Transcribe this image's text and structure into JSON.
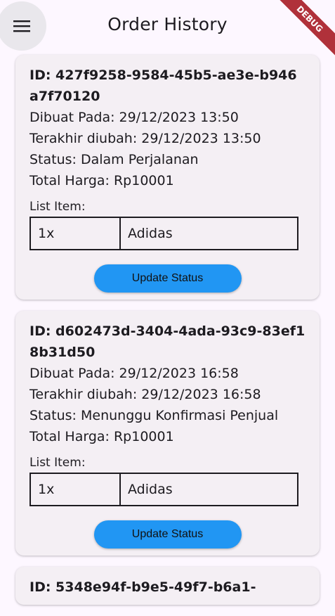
{
  "appbar": {
    "title": "Order History",
    "debug_banner": "DEBUG"
  },
  "labels": {
    "created": "Dibuat Pada: ",
    "updated": "Terakhir diubah: ",
    "status": "Status: ",
    "total": "Total Harga: ",
    "items": "List Item:",
    "update_button": "Update Status"
  },
  "orders": [
    {
      "id": "ID: 427f9258-9584-45b5-ae3e-b946a7f70120",
      "created": "Dibuat Pada: 29/12/2023 13:50",
      "updated": "Terakhir diubah: 29/12/2023 13:50",
      "status": "Status: Dalam Perjalanan",
      "total": "Total Harga: Rp10001",
      "items": [
        {
          "qty": "1x",
          "name": "Adidas"
        }
      ]
    },
    {
      "id": "ID: d602473d-3404-4ada-93c9-83ef18b31d50",
      "created": "Dibuat Pada: 29/12/2023 16:58",
      "updated": "Terakhir diubah: 29/12/2023 16:58",
      "status": "Status: Menunggu Konfirmasi Penjual",
      "total": "Total Harga: Rp10001",
      "items": [
        {
          "qty": "1x",
          "name": "Adidas"
        }
      ]
    },
    {
      "id": "ID: 5348e94f-b9e5-49f7-b6a1-",
      "partial": true
    }
  ],
  "colors": {
    "accent": "#2196f3",
    "card_bg": "#f4eff4",
    "page_bg": "#fdf7ff",
    "debug": "#b0313a"
  },
  "icons": {
    "menu": "menu-icon"
  }
}
